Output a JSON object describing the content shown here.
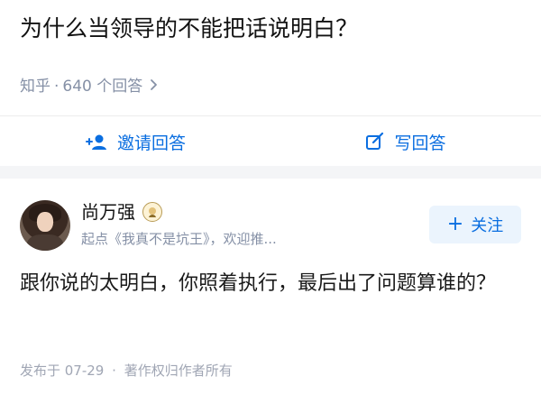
{
  "question": {
    "title": "为什么当领导的不能把话说明白？",
    "meta_source": "知乎",
    "meta_separator": "·",
    "meta_answers": "640 个回答"
  },
  "actions": {
    "invite_label": "邀请回答",
    "write_label": "写回答"
  },
  "answer": {
    "author_name": "尚万强",
    "author_desc": "起点《我真不是坑王》，欢迎推...",
    "follow_label": "关注",
    "body": "跟你说的太明白，你照着执行，最后出了问题算谁的？",
    "published": "发布于 07-29",
    "meta_separator": "·",
    "copyright": "著作权归作者所有"
  },
  "colors": {
    "accent": "#0a6ee0",
    "muted": "#8590a6",
    "follow_bg": "#ebf4fd"
  },
  "icons": {
    "chevron": "chevron-right-icon",
    "invite": "invite-user-icon",
    "write": "edit-icon",
    "badge": "creator-badge-icon",
    "follow": "plus-icon"
  }
}
